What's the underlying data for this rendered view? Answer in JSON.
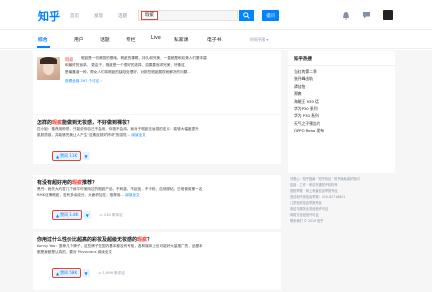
{
  "header": {
    "logo": "知乎",
    "nav": [
      "首页",
      "发现",
      "话题"
    ],
    "search_value": "瑕疵",
    "ask_label": "提问"
  },
  "tabs": [
    "综合",
    "用户",
    "话题",
    "专栏",
    "Live",
    "私家课",
    "电子书"
  ],
  "time_filter": "时间不限",
  "topic": {
    "title": "瑕疵",
    "desc_line1": "瑕疵是一切美丽的基础。瑕疵的裸眼，持久和完美，一直都是和欢美人们基本盾",
    "desc_line2": "和最终的追求。 更由于，瑕疵是一个很好的选择，如果要追求完美，好像这",
    "desc_line3": "是最靠谱一种，帮女人们将瑕疵的缺陷处理好，对那些瑕疵展现而解决的问题…",
    "link": "查看全部 297 个讨论"
  },
  "answers": [
    {
      "title_pre": "怎样的",
      "title_kw": "瑕疵",
      "title_post": "能做到无妆感，不好做到裸妆？",
      "excerpt1": "匹小姐：推荐用粉饼，只能说你自己不会用，你按不会用。我对于瑕疵无妆感的定义：能够大幅度提升",
      "excerpt2": "肌肤质感，并能够完美让人产生\"这素皮肤好好呀\"的感觉…",
      "more": "阅读全文",
      "votes": "赞同 11K",
      "comments": ""
    },
    {
      "title_pre": "有没有超好用的",
      "title_kw": "瑕疵",
      "title_post": "推荐？",
      "excerpt1": "黑丹：我先大约答几个我平时使用过的瑕疵产品，不刺激，不起皮，不卡粉，自然服帖。日常使用第一名",
      "excerpt2": "RMK丝滑瑕疵，没有多余成分，大面积加在，推荐用…",
      "more": "阅读全文",
      "votes": "赞同 1.8K",
      "comments": "230 条评论"
    },
    {
      "title_pre": "你用过什么性价比超高的彩妆及超级无妆感的",
      "title_kw": "瑕疵",
      "title_post": "？",
      "excerpt1": "Konny Yao：推荐几个牌子，这些牌子在国内基本都没有专柜，各种媒体上也可能好大量推广的，品基本",
      "excerpt2": "都是我都是认真的，要对 Physicians 阅读全文",
      "more": "阅读全文",
      "votes": "赞同 58K",
      "comments": "1,699 条评论"
    }
  ],
  "sidebar": {
    "title": "知乎热搜",
    "items": [
      "当红的第二季",
      "张丹峰出轨",
      "谭佳怡",
      "郑爽",
      "海贼王 939 话",
      "华为P30 系列",
      "华为 P30 系列",
      "天气之子预告片",
      "OPPO Reno 发布"
    ],
    "footer": [
      "刘看山 · 知乎指南 · 知乎协议 · 知乎隐私保护指引",
      "应用 · 工作 · 申请开通知乎机构号",
      "侵权举报 · 网上有害信息举报专区",
      "违法和不良信息举报：010-82716601",
      "儿童色情信息举报专区",
      "电信与服务业务经营许可证",
      "网络文化经营许可证",
      "联系我们 © 2019 知乎"
    ]
  },
  "colors": {
    "brand": "#0084ff",
    "highlight": "#f1403c",
    "annotation": "#e0443a"
  }
}
